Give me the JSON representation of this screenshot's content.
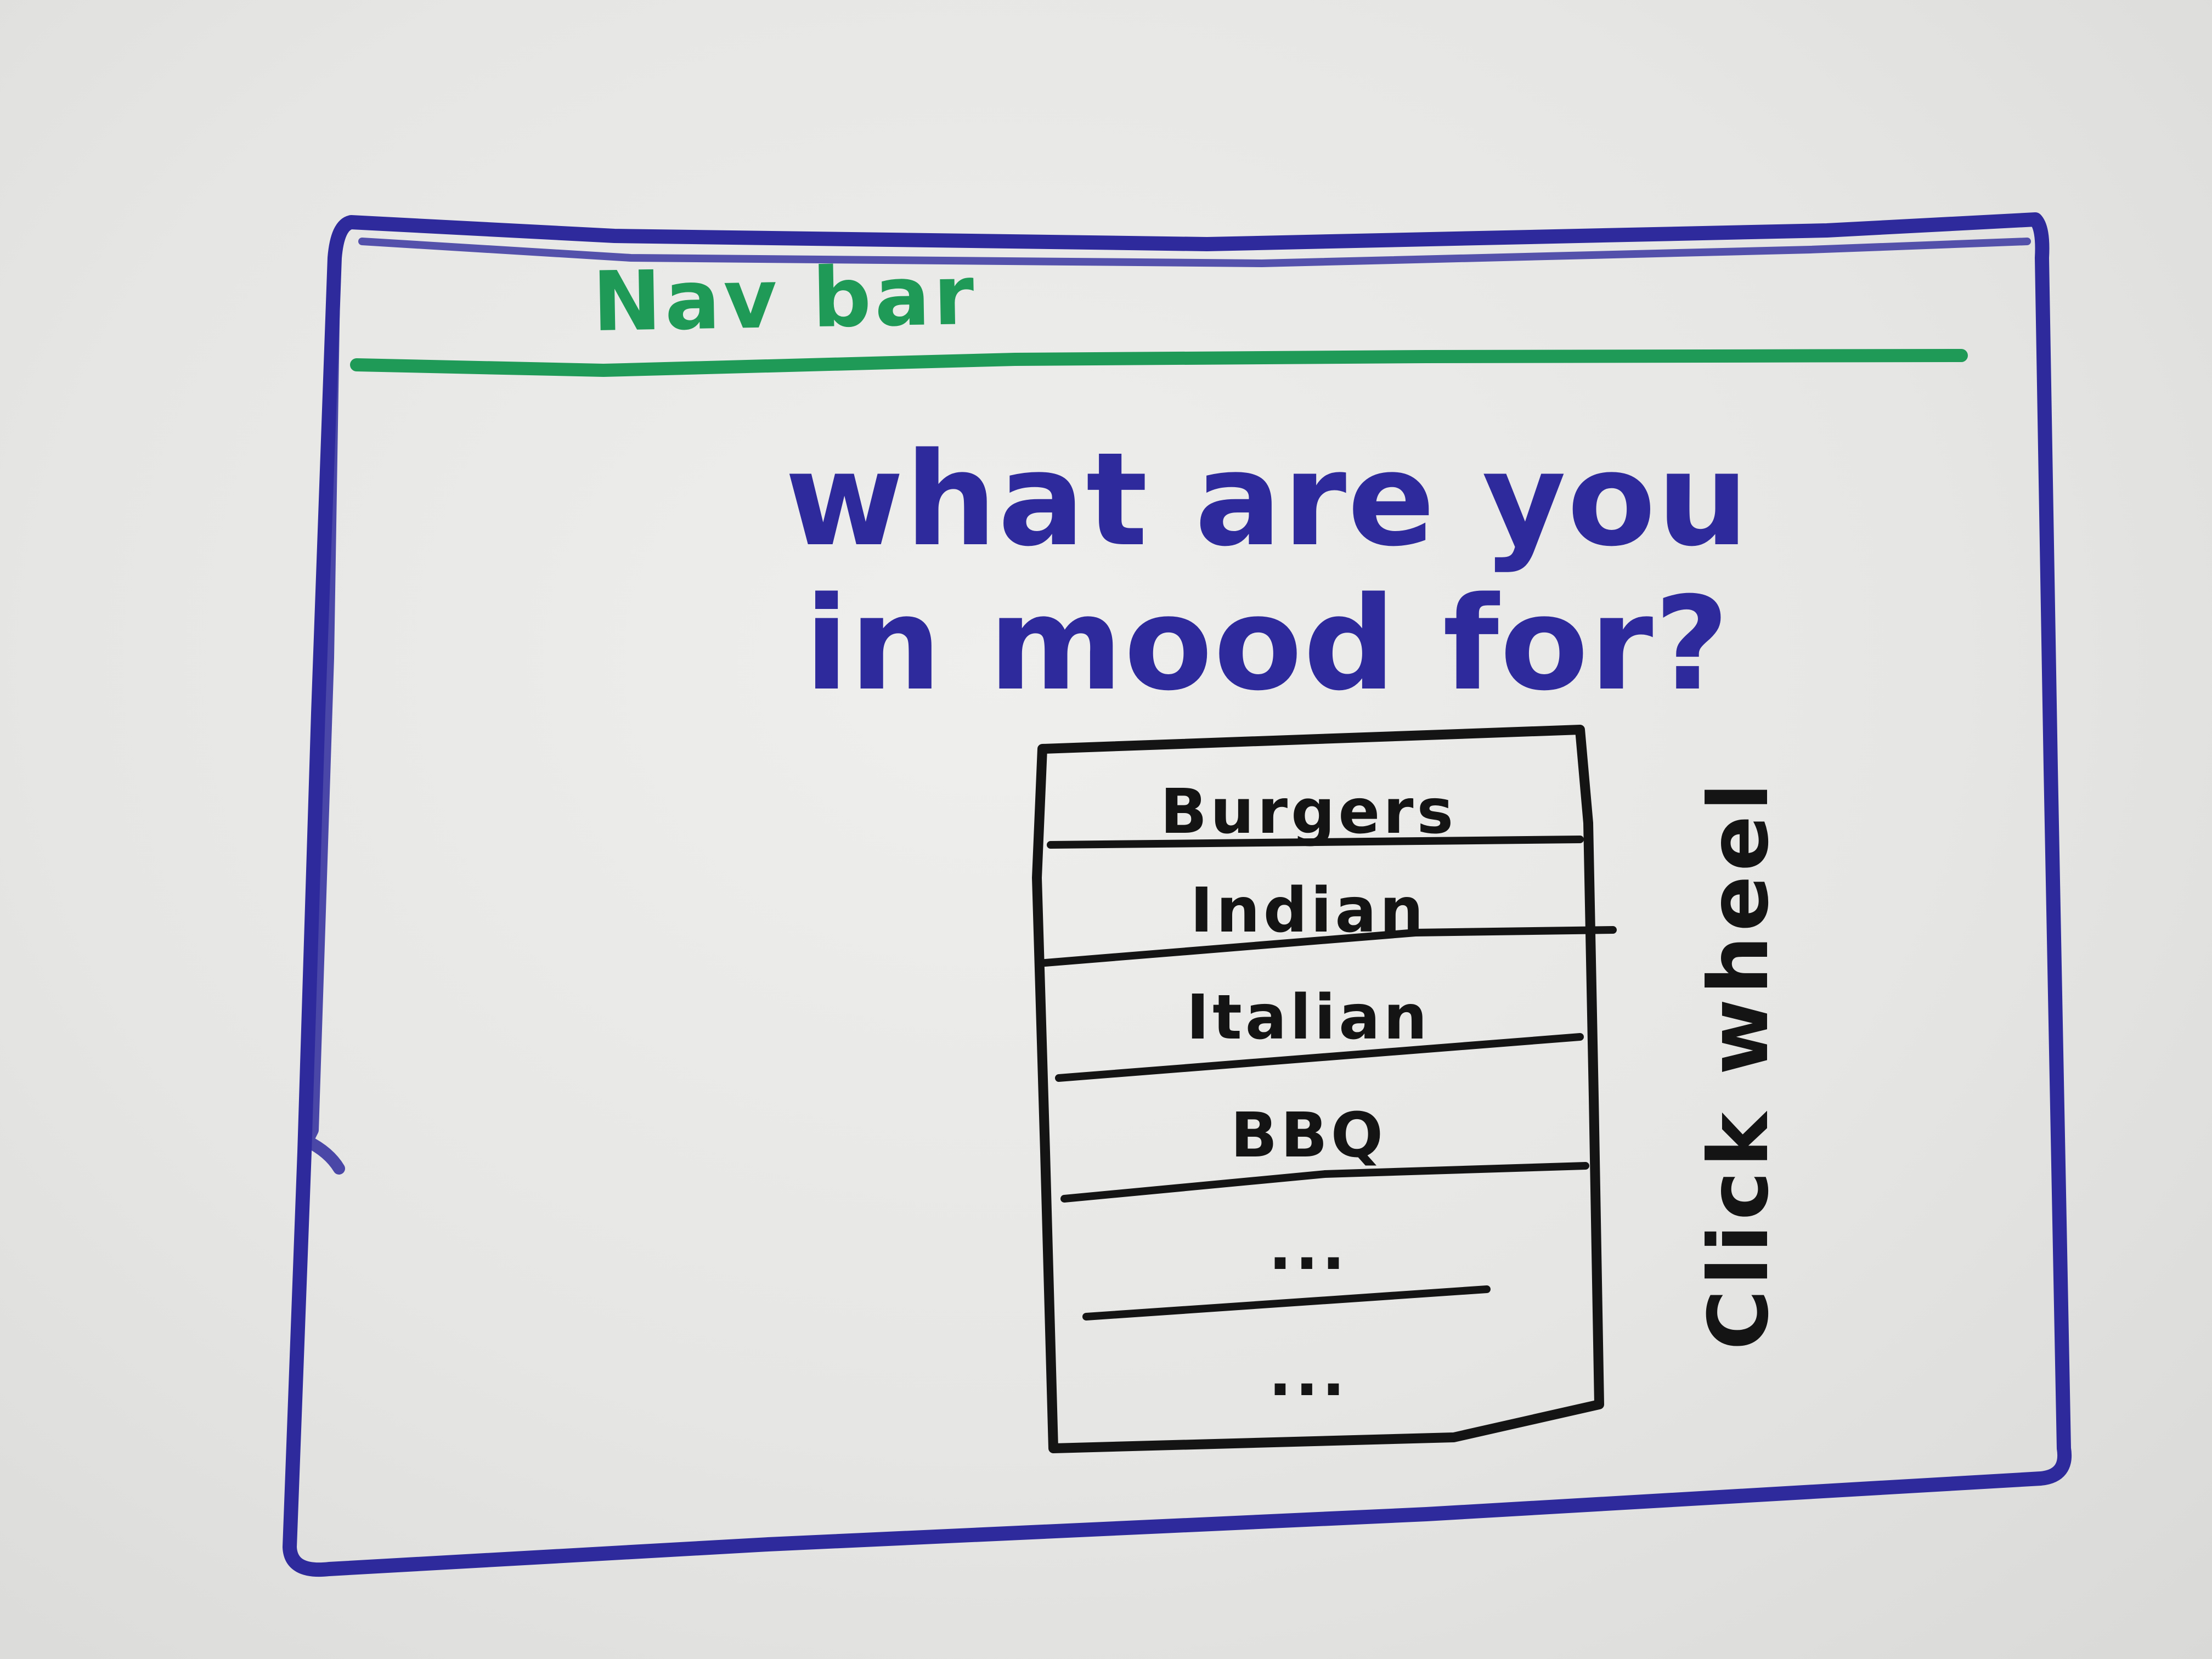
{
  "navbar": {
    "label": "Nav bar"
  },
  "main": {
    "heading": "what are you in mood for?"
  },
  "click_wheel": {
    "label": "Click wheel",
    "items": [
      "Burgers",
      "Indian",
      "Italian",
      "BBQ",
      "...",
      "..."
    ]
  },
  "colors": {
    "frame_marker": "#2e2a9c",
    "navbar_marker": "#1f9a57",
    "wheel_marker": "#141414",
    "whiteboard": "#e9e9e7"
  }
}
